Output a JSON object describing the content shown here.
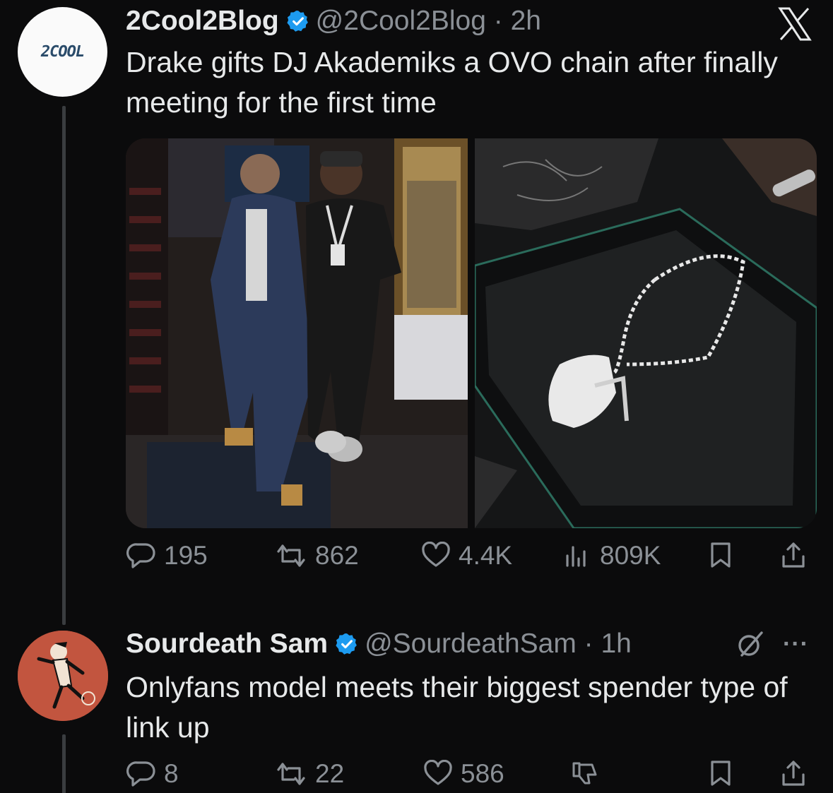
{
  "tweet": {
    "author_name": "2Cool2Blog",
    "handle_time": "@2Cool2Blog · 2h",
    "avatar_text": "2COOL",
    "text": "Drake gifts DJ Akademiks a OVO chain after finally meeting for the first time",
    "stats": {
      "replies": "195",
      "reposts": "862",
      "likes": "4.4K",
      "views": "809K"
    }
  },
  "reply": {
    "author_name": "Sourdeath Sam",
    "handle_time": "@SourdeathSam · 1h",
    "text": "Onlyfans model meets their biggest spender type of link up",
    "stats": {
      "replies": "8",
      "reposts": "22",
      "likes": "586"
    }
  },
  "colors": {
    "background": "#0b0b0c",
    "text": "#e7e9ea",
    "muted": "#8b9096",
    "verified": "#1d9bf0"
  }
}
